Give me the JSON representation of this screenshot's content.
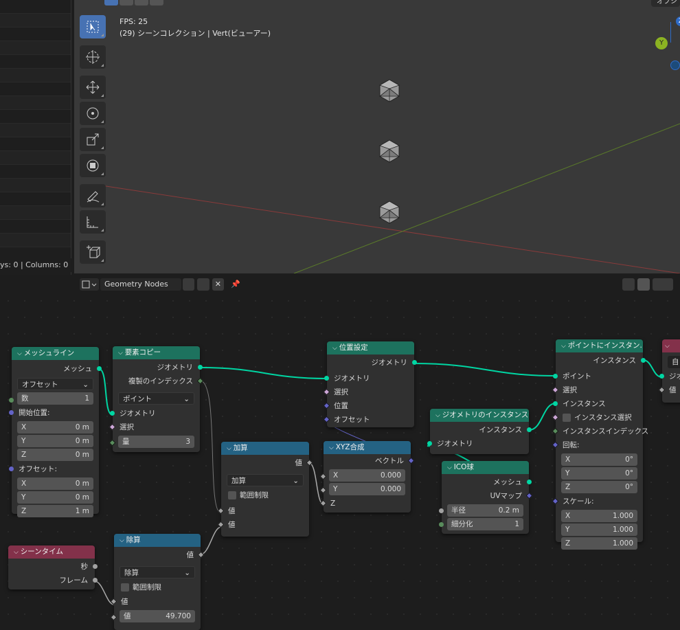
{
  "status": {
    "text": "ys: 0   |   Columns: 0"
  },
  "viewport": {
    "fps": "FPS: 25",
    "collection": "(29) シーンコレクション | Vert(ビューアー)",
    "top_right": "オプシ",
    "axis_z": "Z",
    "axis_y": "Y"
  },
  "editor": {
    "title": "Geometry Nodes"
  },
  "nodes": {
    "mesh_line": {
      "title": "メッシュライン",
      "out_mesh": "メッシュ",
      "mode": "オフセット",
      "count_label": "数",
      "count": "1",
      "start_label": "開始位置:",
      "sx": "X",
      "sx_v": "0 m",
      "sy": "Y",
      "sy_v": "0 m",
      "sz": "Z",
      "sz_v": "0 m",
      "offset_label": "オフセット:",
      "ox": "X",
      "ox_v": "0 m",
      "oy": "Y",
      "oy_v": "0 m",
      "oz": "Z",
      "oz_v": "1 m"
    },
    "dup": {
      "title": "要素コピー",
      "out_geo": "ジオメトリ",
      "out_idx": "複製のインデックス",
      "domain": "ポイント",
      "in_geo": "ジオメトリ",
      "in_sel": "選択",
      "amount_label": "量",
      "amount": "3"
    },
    "setpos": {
      "title": "位置設定",
      "out_geo": "ジオメトリ",
      "in_geo": "ジオメトリ",
      "in_sel": "選択",
      "in_pos": "位置",
      "in_off": "オフセット"
    },
    "add": {
      "title": "加算",
      "out": "値",
      "op": "加算",
      "clamp": "範囲制限",
      "in1": "値",
      "in2": "値"
    },
    "combine": {
      "title": "XYZ合成",
      "out": "ベクトル",
      "x": "X",
      "x_v": "0.000",
      "y": "Y",
      "y_v": "0.000",
      "z": "Z"
    },
    "realize": {
      "title": "ジオメトリのインスタンス化",
      "out": "インスタンス",
      "in": "ジオメトリ"
    },
    "ico": {
      "title": "ICO球",
      "out_mesh": "メッシュ",
      "out_uv": "UVマップ",
      "radius_label": "半径",
      "radius": "0.2 m",
      "sub_label": "細分化",
      "sub": "1"
    },
    "inst": {
      "title": "ポイントにインスタン...",
      "out": "インスタンス",
      "in_pts": "ポイント",
      "in_sel": "選択",
      "in_inst": "インスタンス",
      "in_instsel": "インスタンス選択",
      "in_idx": "インスタンスインデックス",
      "rot_label": "回転:",
      "rx": "X",
      "rx_v": "0°",
      "ry": "Y",
      "ry_v": "0°",
      "rz": "Z",
      "rz_v": "0°",
      "scale_label": "スケール:",
      "scx": "X",
      "scx_v": "1.000",
      "scy": "Y",
      "scy_v": "1.000",
      "scz": "Z",
      "scz_v": "1.000"
    },
    "time": {
      "title": "シーンタイム",
      "sec": "秒",
      "frame": "フレーム"
    },
    "div": {
      "title": "除算",
      "out": "値",
      "op": "除算",
      "clamp": "範囲制限",
      "in1": "値",
      "val_label": "値",
      "val": "49.700"
    },
    "edge": {
      "t1": "自",
      "geo": "ジオ",
      "val": "値"
    }
  }
}
